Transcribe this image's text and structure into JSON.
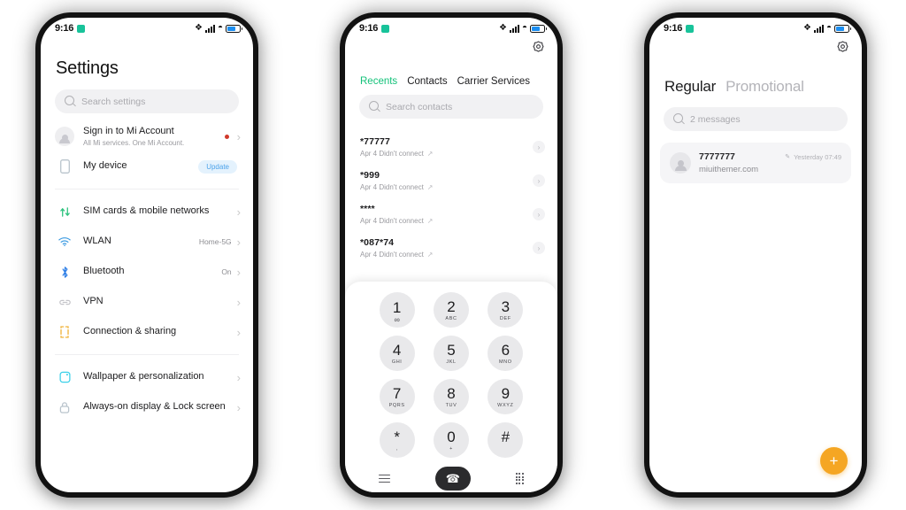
{
  "status_bar": {
    "time": "9:16",
    "icons": [
      "notification-chip-icon",
      "bluetooth-icon",
      "signal-bars-icon",
      "wifi-icon",
      "battery-icon"
    ]
  },
  "colors": {
    "accent_green": "#14c27a",
    "accent_blue": "#1b8ef2",
    "accent_orange": "#f5a623",
    "badge_blue_bg": "#e4f2fd",
    "badge_blue_text": "#4da3ea",
    "red_dot": "#d0392b",
    "frame_black": "#121212",
    "search_bg": "#f1f1f3"
  },
  "settings": {
    "title": "Settings",
    "search": {
      "placeholder": "Search settings"
    },
    "account": {
      "label": "Sign in to Mi Account",
      "sub": "All Mi services. One Mi Account."
    },
    "device": {
      "label": "My device",
      "badge": "Update"
    },
    "group_network": [
      {
        "label": "SIM cards & mobile networks",
        "value": "",
        "icon": "sim-swap-icon",
        "color": "#2ec27e"
      },
      {
        "label": "WLAN",
        "value": "Home-5G",
        "icon": "wifi-icon",
        "color": "#3b9ae1"
      },
      {
        "label": "Bluetooth",
        "value": "On",
        "icon": "bluetooth-icon",
        "color": "#2f7fe6"
      },
      {
        "label": "VPN",
        "value": "",
        "icon": "vpn-link-icon",
        "color": "#c4c4c9"
      },
      {
        "label": "Connection & sharing",
        "value": "",
        "icon": "connection-sharing-icon",
        "color": "#f0b43c"
      }
    ],
    "group_display": [
      {
        "label": "Wallpaper & personalization",
        "value": "",
        "icon": "wallpaper-icon",
        "color": "#3ad0e8"
      },
      {
        "label": "Always-on display & Lock screen",
        "value": "",
        "icon": "lock-icon",
        "color": "#b9c4cc"
      }
    ]
  },
  "dialer": {
    "settings_icon": "gear-icon",
    "tabs": [
      {
        "label": "Recents",
        "active": true
      },
      {
        "label": "Contacts",
        "active": false
      },
      {
        "label": "Carrier Services",
        "active": false
      }
    ],
    "search": {
      "placeholder": "Search contacts"
    },
    "calls": [
      {
        "number": "*77777",
        "meta": "Apr 4 Didn't connect"
      },
      {
        "number": "*999",
        "meta": "Apr 4 Didn't connect"
      },
      {
        "number": "****",
        "meta": "Apr 4 Didn't connect"
      },
      {
        "number": "*087*74",
        "meta": "Apr 4 Didn't connect"
      }
    ],
    "keys": [
      {
        "digit": "1",
        "sub": "∞",
        "sub_is_symbol": true
      },
      {
        "digit": "2",
        "sub": "ABC"
      },
      {
        "digit": "3",
        "sub": "DEF"
      },
      {
        "digit": "4",
        "sub": "GHI"
      },
      {
        "digit": "5",
        "sub": "JKL"
      },
      {
        "digit": "6",
        "sub": "MNO"
      },
      {
        "digit": "7",
        "sub": "PQRS"
      },
      {
        "digit": "8",
        "sub": "TUV"
      },
      {
        "digit": "9",
        "sub": "WXYZ"
      },
      {
        "digit": "*",
        "sub": ","
      },
      {
        "digit": "0",
        "sub": "+"
      },
      {
        "digit": "#",
        "sub": ""
      }
    ],
    "bottom_nav": {
      "menu_icon": "hamburger-menu-icon",
      "call_icon": "phone-call-icon",
      "keypad_icon": "keypad-grid-icon"
    }
  },
  "messages": {
    "settings_icon": "gear-icon",
    "tabs": [
      {
        "label": "Regular",
        "active": true
      },
      {
        "label": "Promotional",
        "active": false
      }
    ],
    "search": {
      "placeholder": "2 messages"
    },
    "threads": [
      {
        "name": "7777777",
        "preview": "miuithemer.com",
        "time": "Yesterday 07:49",
        "pen_icon": "draft-pencil-icon"
      }
    ],
    "fab": {
      "label": "+",
      "icon": "add-message-icon"
    }
  }
}
